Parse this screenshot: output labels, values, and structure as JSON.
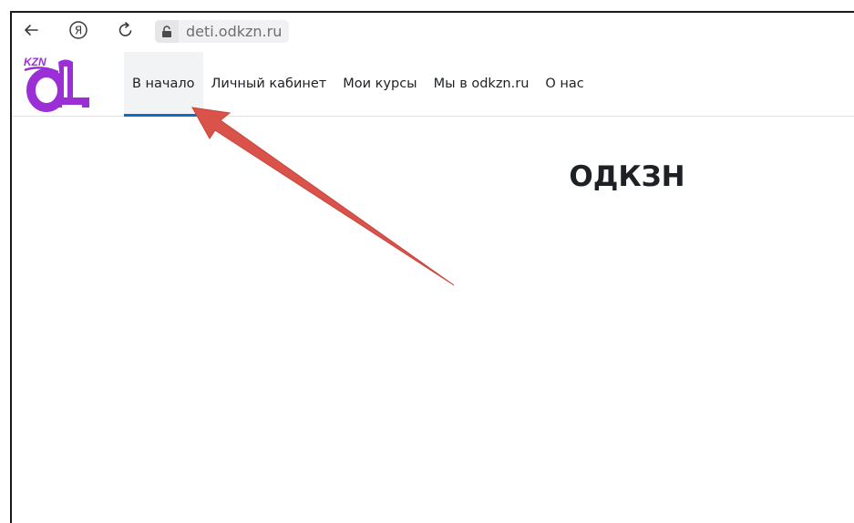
{
  "browser": {
    "url": "deti.odkzn.ru"
  },
  "site": {
    "logo_text": "KZN",
    "nav": [
      {
        "label": "В начало",
        "active": true
      },
      {
        "label": "Личный кабинет",
        "active": false
      },
      {
        "label": "Мои курсы",
        "active": false
      },
      {
        "label": "Мы в odkzn.ru",
        "active": false
      },
      {
        "label": "О нас",
        "active": false
      }
    ],
    "page_title": "ОДКЗН"
  },
  "colors": {
    "logo_purple": "#9b2fd6",
    "nav_active_underline": "#0f6cbf",
    "annotation_arrow": "#d9534a"
  },
  "icons": [
    "back-arrow-icon",
    "yandex-icon",
    "reload-icon",
    "lock-icon"
  ]
}
